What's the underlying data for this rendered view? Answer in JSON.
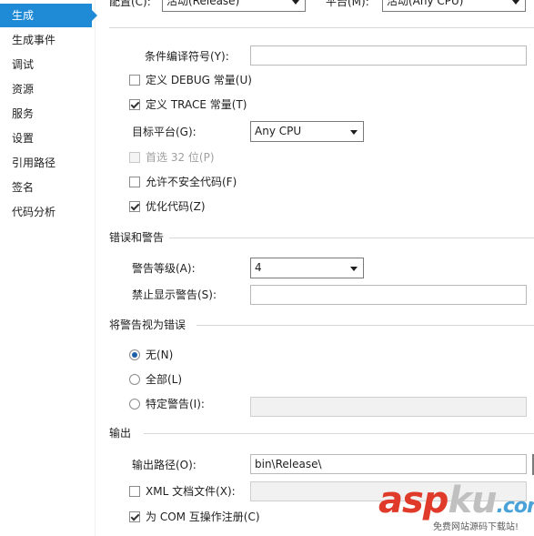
{
  "sidebar": {
    "items": [
      {
        "label": "生成",
        "active": true
      },
      {
        "label": "生成事件"
      },
      {
        "label": "调试"
      },
      {
        "label": "资源"
      },
      {
        "label": "服务"
      },
      {
        "label": "设置"
      },
      {
        "label": "引用路径"
      },
      {
        "label": "签名"
      },
      {
        "label": "代码分析"
      }
    ]
  },
  "top": {
    "config_label": "配置(C):",
    "config_value": "活动(Release)",
    "platform_label": "平台(M):",
    "platform_value": "活动(Any CPU)"
  },
  "general": {
    "conditional_symbols_label": "条件编译符号(Y):",
    "conditional_symbols_value": "",
    "define_debug_label": "定义 DEBUG 常量(U)",
    "define_debug_checked": false,
    "define_trace_label": "定义 TRACE 常量(T)",
    "define_trace_checked": true,
    "platform_target_label": "目标平台(G):",
    "platform_target_value": "Any CPU",
    "prefer32_label": "首选 32 位(P)",
    "prefer32_checked": false,
    "unsafe_label": "允许不安全代码(F)",
    "unsafe_checked": false,
    "optimize_label": "优化代码(Z)",
    "optimize_checked": true
  },
  "errors": {
    "section_title": "错误和警告",
    "warning_level_label": "警告等级(A):",
    "warning_level_value": "4",
    "suppress_label": "禁止显示警告(S):",
    "suppress_value": ""
  },
  "treat_warnings": {
    "section_title": "将警告视为错误",
    "none_label": "无(N)",
    "all_label": "全部(L)",
    "specific_label": "特定警告(I):",
    "selected": "none",
    "specific_value": ""
  },
  "output": {
    "section_title": "输出",
    "path_label": "输出路径(O):",
    "path_value": "bin\\Release\\",
    "xml_label": "XML 文档文件(X):",
    "xml_checked": false,
    "xml_value": "",
    "com_label": "为 COM 互操作注册(C)",
    "com_checked": true
  },
  "watermark": {
    "brand_a": "asp",
    "brand_b": "ku",
    "brand_c": ".com",
    "subtitle": "免费网站源码下载站!"
  }
}
